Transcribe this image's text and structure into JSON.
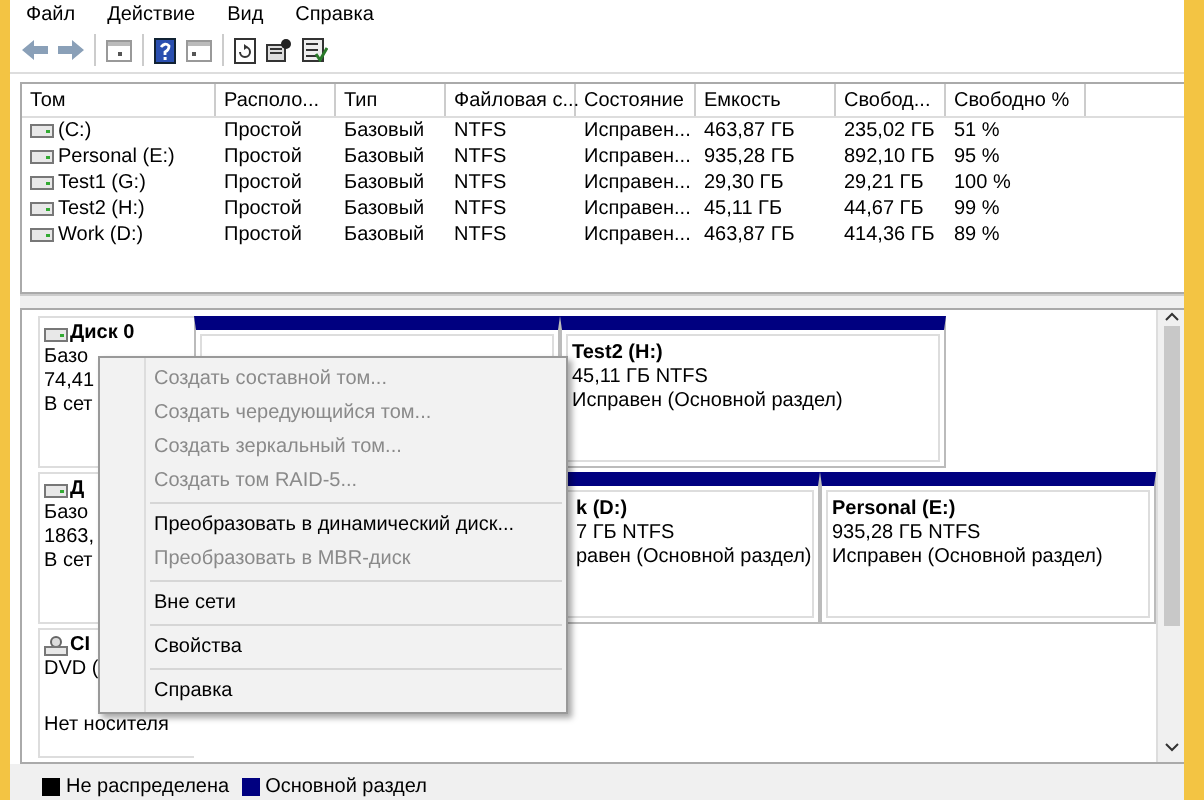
{
  "menu": [
    "Файл",
    "Действие",
    "Вид",
    "Справка"
  ],
  "volumes": {
    "columns": [
      "Том",
      "Располо...",
      "Тип",
      "Файловая с...",
      "Состояние",
      "Емкость",
      "Свобод...",
      "Свободно %"
    ],
    "rows": [
      {
        "cells": [
          "(C:)",
          "Простой",
          "Базовый",
          "NTFS",
          "Исправен...",
          "463,87 ГБ",
          "235,02 ГБ",
          "51 %"
        ]
      },
      {
        "cells": [
          "Personal (E:)",
          "Простой",
          "Базовый",
          "NTFS",
          "Исправен...",
          "935,28 ГБ",
          "892,10 ГБ",
          "95 %"
        ]
      },
      {
        "cells": [
          "Test1 (G:)",
          "Простой",
          "Базовый",
          "NTFS",
          "Исправен...",
          "29,30 ГБ",
          "29,21 ГБ",
          "100 %"
        ]
      },
      {
        "cells": [
          "Test2 (H:)",
          "Простой",
          "Базовый",
          "NTFS",
          "Исправен...",
          "45,11 ГБ",
          "44,67 ГБ",
          "99 %"
        ]
      },
      {
        "cells": [
          "Work (D:)",
          "Простой",
          "Базовый",
          "NTFS",
          "Исправен...",
          "463,87 ГБ",
          "414,36 ГБ",
          "89 %"
        ]
      }
    ]
  },
  "disks": [
    {
      "kind": "disk",
      "name": "Диск 0",
      "lines": [
        "Базо",
        "74,41",
        "В сет"
      ],
      "partitions": [
        {
          "kind": "partition"
        },
        {
          "kind": "partition",
          "name": "Test2  (H:)",
          "lines": [
            "45,11 ГБ NTFS",
            "Исправен (Основной раздел)"
          ]
        }
      ]
    },
    {
      "kind": "disk",
      "name": "Д",
      "lines": [
        "Базо",
        "1863,",
        "В сет"
      ],
      "partitions": [
        {
          "kind": "partition",
          "name": "k  (D:)",
          "lines": [
            "7 ГБ NTFS",
            "равен (Основной раздел)"
          ]
        },
        {
          "kind": "partition",
          "name": "Personal  (E:)",
          "lines": [
            "935,28 ГБ NTFS",
            "Исправен (Основной раздел)"
          ]
        }
      ]
    },
    {
      "kind": "cdrom",
      "name": "CI",
      "lines": [
        "DVD (",
        "Нет носителя"
      ]
    }
  ],
  "context_menu": [
    {
      "kind": "item",
      "label": "Создать составной том...",
      "disabled": true
    },
    {
      "kind": "item",
      "label": "Создать чередующийся том...",
      "disabled": true
    },
    {
      "kind": "item",
      "label": "Создать зеркальный том...",
      "disabled": true
    },
    {
      "kind": "item",
      "label": "Создать том RAID-5...",
      "disabled": true
    },
    {
      "kind": "separator"
    },
    {
      "kind": "item",
      "label": "Преобразовать в динамический диск...",
      "disabled": false
    },
    {
      "kind": "item",
      "label": "Преобразовать в MBR-диск",
      "disabled": true
    },
    {
      "kind": "separator"
    },
    {
      "kind": "item",
      "label": "Вне сети",
      "disabled": false
    },
    {
      "kind": "separator"
    },
    {
      "kind": "item",
      "label": "Свойства",
      "disabled": false
    },
    {
      "kind": "separator"
    },
    {
      "kind": "item",
      "label": "Справка",
      "disabled": false
    }
  ],
  "legend": [
    {
      "label": "Не распределена",
      "color": "#000000"
    },
    {
      "label": "Основной раздел",
      "color": "#000080"
    }
  ]
}
